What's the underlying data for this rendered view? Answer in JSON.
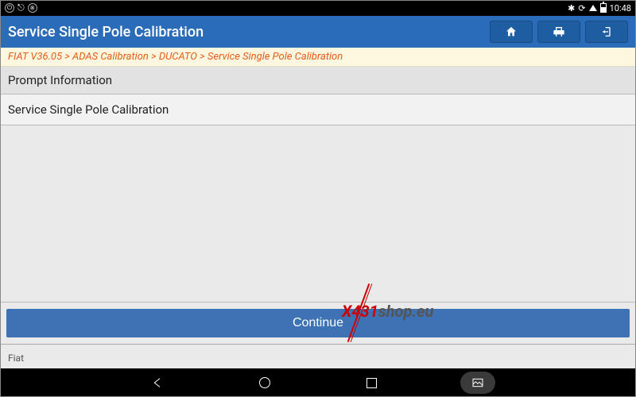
{
  "statusbar": {
    "time": "10:48"
  },
  "titlebar": {
    "title": "Service Single Pole Calibration"
  },
  "breadcrumb": {
    "text": "FIAT V36.05 > ADAS Calibration > DUCATO > Service Single Pole Calibration"
  },
  "content": {
    "prompt_header": "Prompt Information",
    "item1": "Service Single Pole Calibration",
    "continue_label": "Continue"
  },
  "footer": {
    "brand": "Fiat"
  },
  "watermark": {
    "head": "X431",
    "tail": "shop.eu"
  }
}
